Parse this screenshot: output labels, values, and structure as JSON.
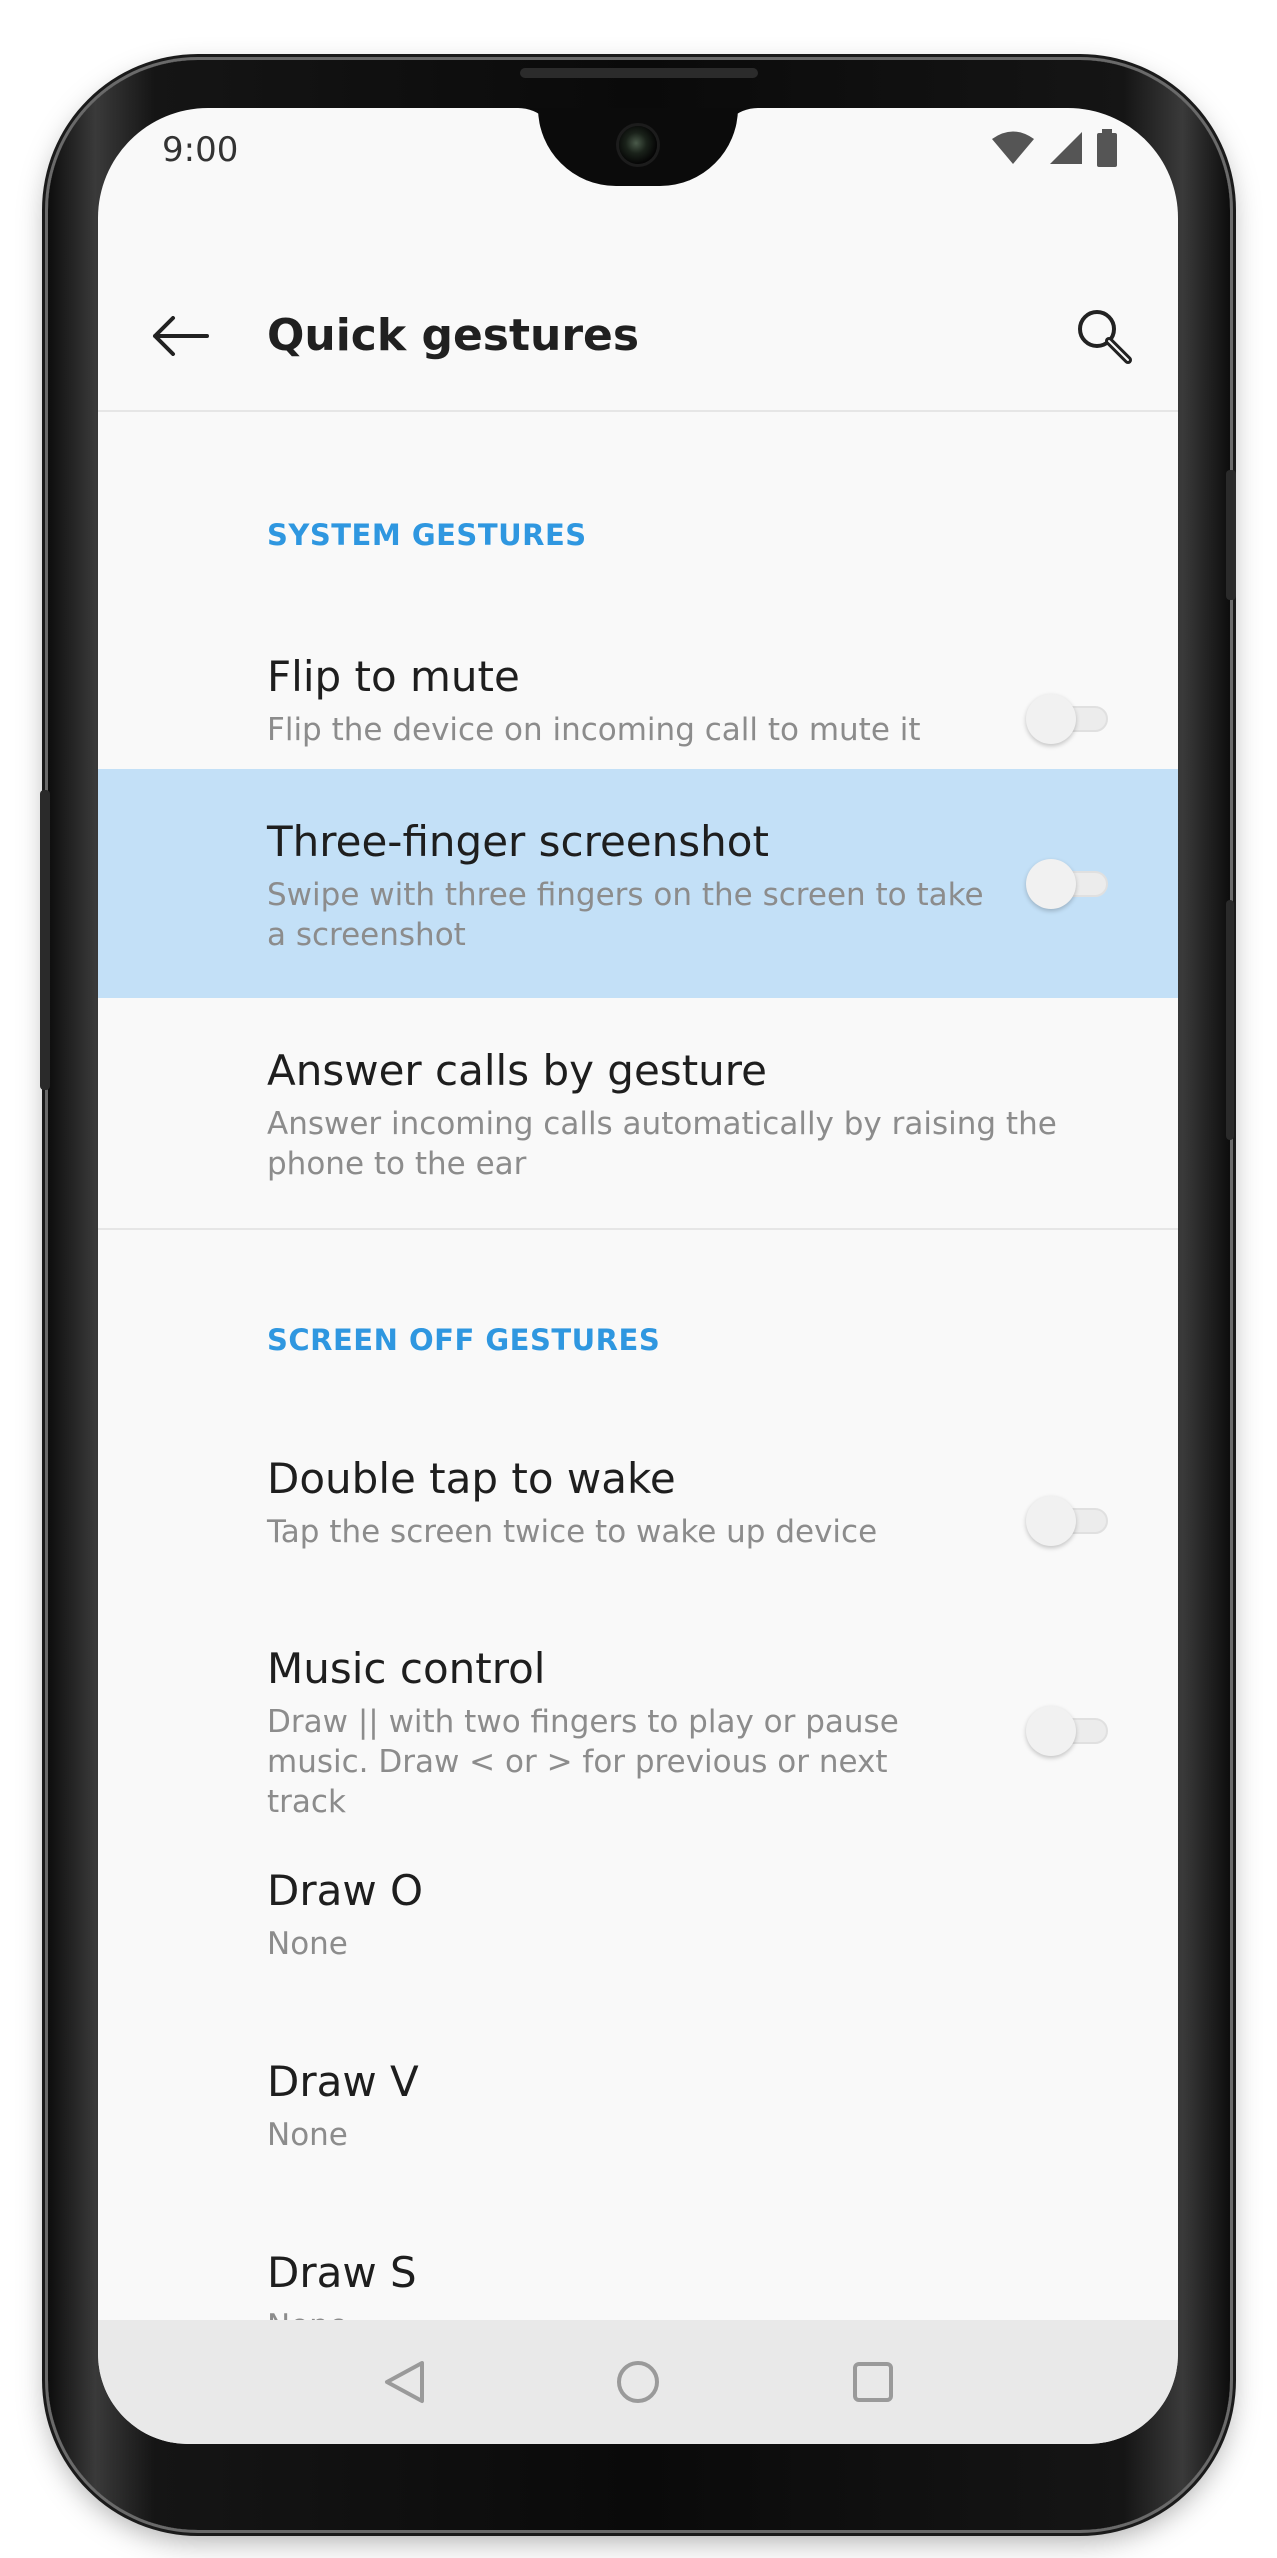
{
  "status_bar": {
    "time": "9:00",
    "icons": [
      "wifi-icon",
      "cellular-signal-icon",
      "battery-icon"
    ]
  },
  "toolbar": {
    "title": "Quick gestures",
    "back_icon": "arrow-left-icon",
    "search_icon": "search-icon"
  },
  "sections": [
    {
      "header": "SYSTEM GESTURES",
      "items": [
        {
          "title": "Flip to mute",
          "subtitle": "Flip the device on incoming call to mute it",
          "toggle": false
        },
        {
          "title": "Three-finger screenshot",
          "subtitle": "Swipe with three fingers on the screen to take a screenshot",
          "toggle": false,
          "highlighted": true
        },
        {
          "title": "Answer calls by gesture",
          "subtitle": "Answer incoming calls automatically by raising the phone to the ear"
        }
      ]
    },
    {
      "header": "SCREEN OFF GESTURES",
      "items": [
        {
          "title": "Double tap to wake",
          "subtitle": "Tap the screen twice to wake up device",
          "toggle": false
        },
        {
          "title": "Music control",
          "subtitle": "Draw || with two fingers to play or pause music. Draw < or > for previous or next track",
          "toggle": false
        },
        {
          "title": "Draw O",
          "subtitle": "None"
        },
        {
          "title": "Draw V",
          "subtitle": "None"
        },
        {
          "title": "Draw S",
          "subtitle": "None"
        }
      ]
    }
  ],
  "navbar": {
    "icons": [
      "nav-back-icon",
      "nav-home-icon",
      "nav-recents-icon"
    ]
  },
  "colors": {
    "accent": "#2f97e0",
    "highlight": "#c3e0f7",
    "background": "#f9f9f9",
    "navbar": "#e9e9e9"
  }
}
